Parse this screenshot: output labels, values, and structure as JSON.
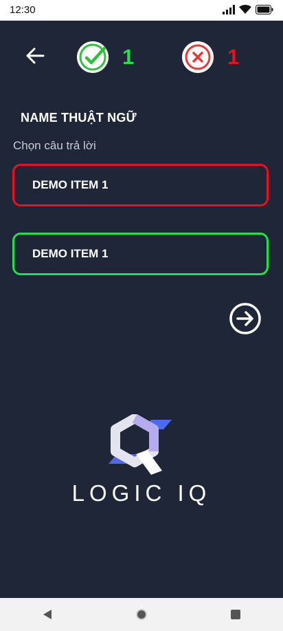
{
  "status_bar": {
    "time": "12:30",
    "icons": [
      "signal-icon",
      "wifi-icon",
      "battery-icon"
    ]
  },
  "header": {
    "back_icon": "arrow-left-icon",
    "correct_count": "1",
    "wrong_count": "1",
    "colors": {
      "correct": "#24e04d",
      "wrong": "#e8111d"
    }
  },
  "question": {
    "title": "NAME THUẬT NGỮ",
    "prompt": "Chọn câu trả lời"
  },
  "answers": [
    {
      "label": "DEMO ITEM 1",
      "state": "wrong"
    },
    {
      "label": "DEMO ITEM 1",
      "state": "correct"
    }
  ],
  "next_icon": "arrow-right-circle-icon",
  "brand": {
    "name": "LOGIC IQ"
  },
  "nav_bar": {
    "items": [
      "back-triangle-icon",
      "home-circle-icon",
      "recents-square-icon"
    ]
  },
  "theme": {
    "background": "#1e2638"
  }
}
